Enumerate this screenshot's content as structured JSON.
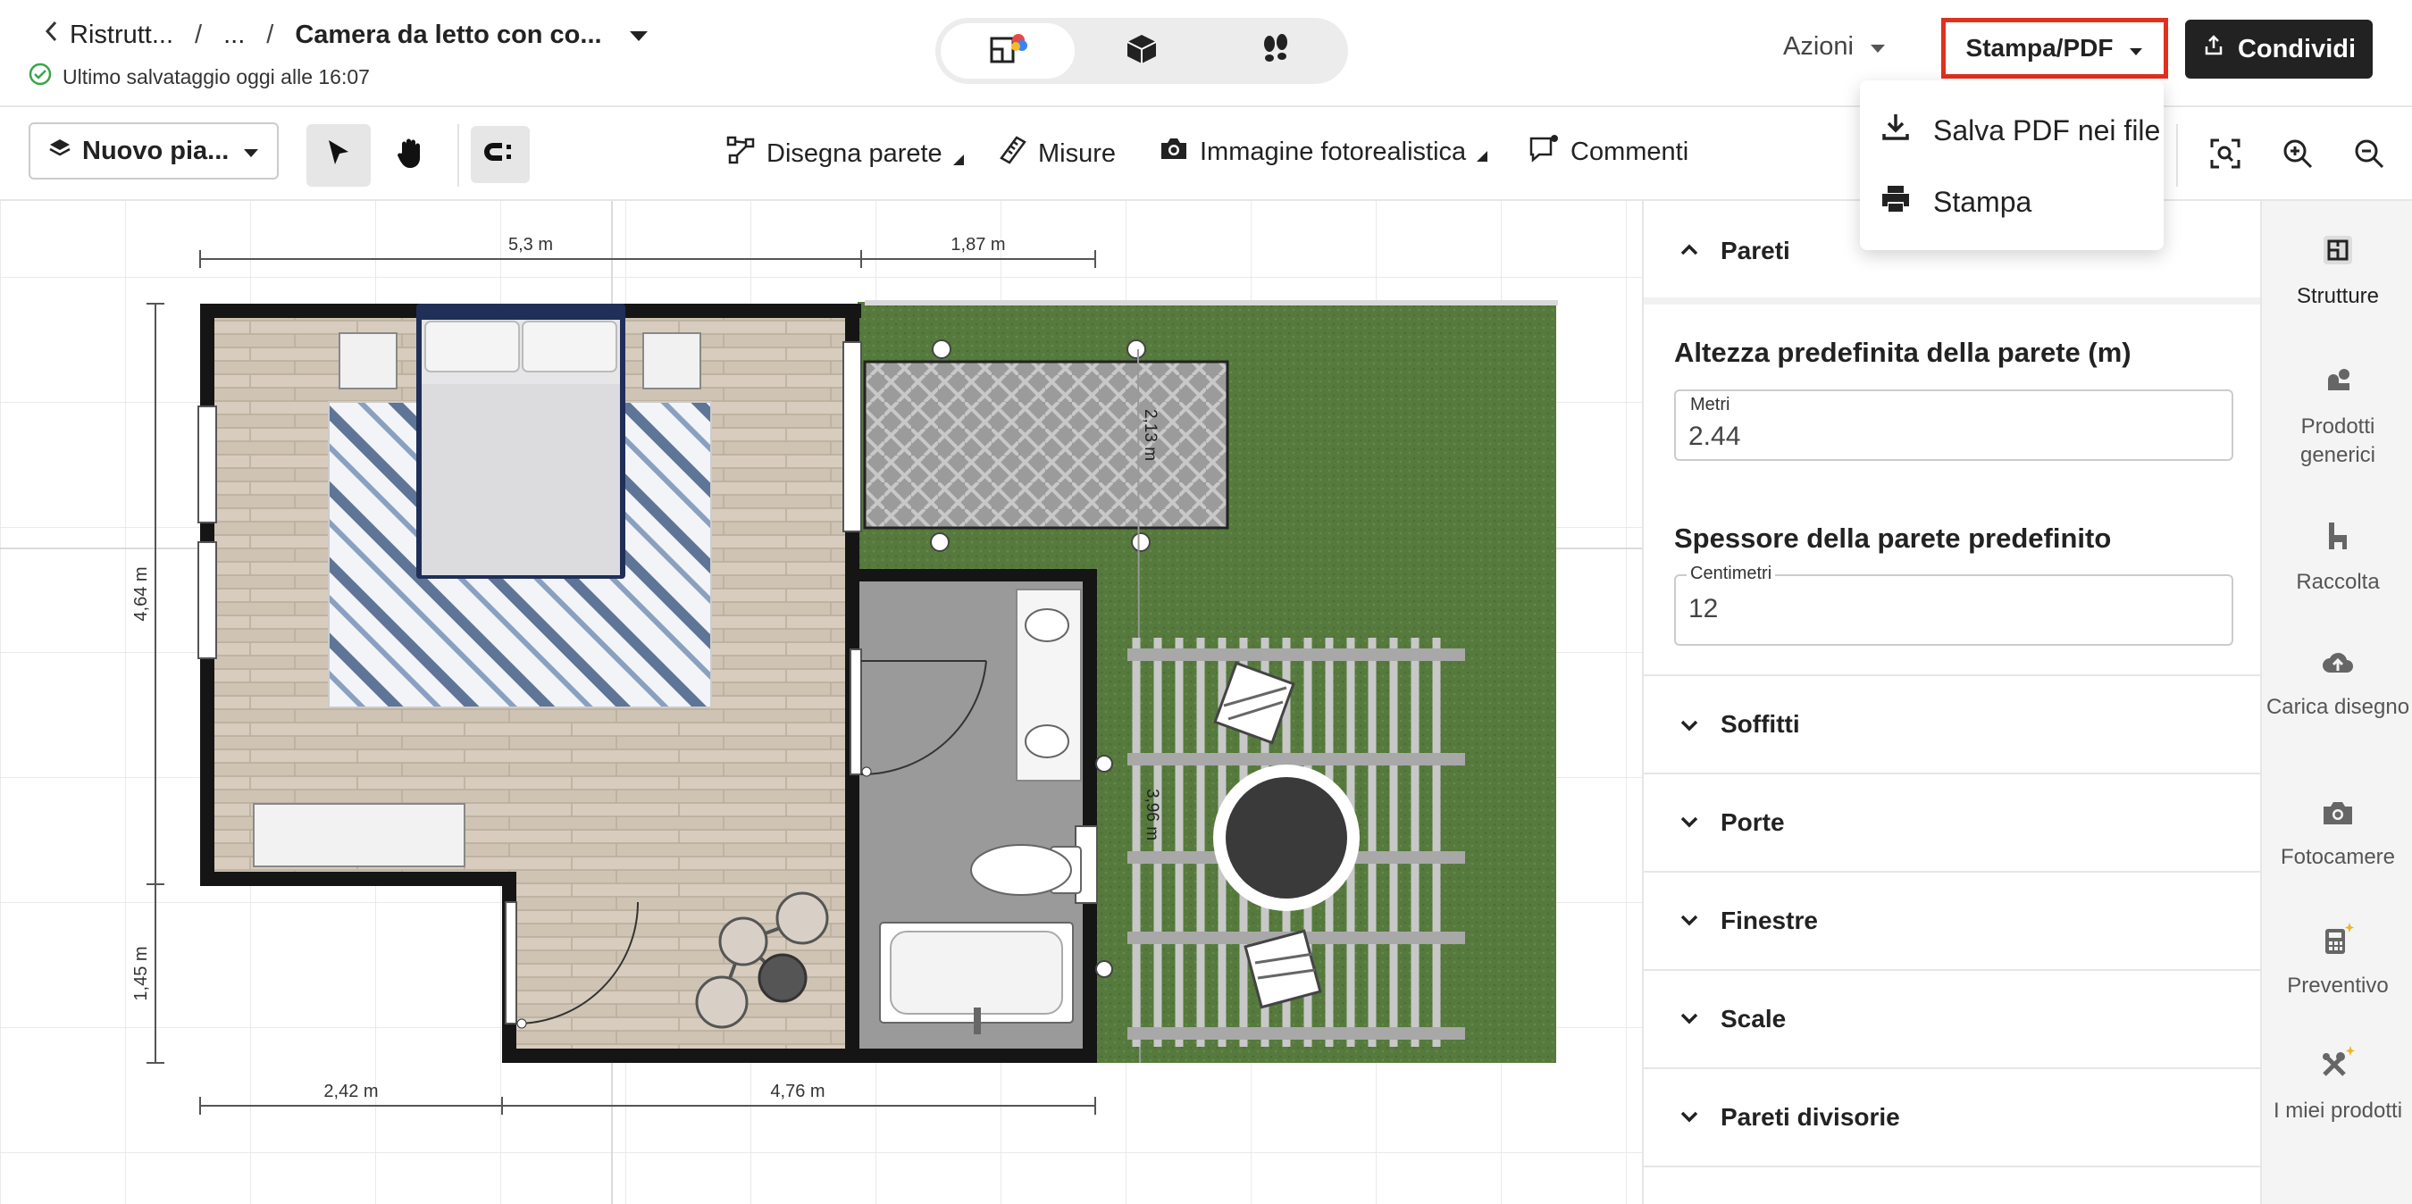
{
  "breadcrumb": {
    "back": "Ristrutt...",
    "ellipsis": "...",
    "current": "Camera da letto con co..."
  },
  "save_status": "Ultimo salvataggio oggi alle 16:07",
  "header": {
    "actions_label": "Azioni",
    "print_label": "Stampa/PDF",
    "share_label": "Condividi"
  },
  "dropdown": {
    "items": [
      {
        "label": "Salva PDF nei file",
        "icon": "download-icon"
      },
      {
        "label": "Stampa",
        "icon": "printer-icon"
      }
    ]
  },
  "toolbar": {
    "floor": "Nuovo pia...",
    "draw_wall": "Disegna parete",
    "measures": "Misure",
    "photo": "Immagine fotorealistica",
    "comments": "Commenti"
  },
  "plan": {
    "dims": {
      "top_left": "5,3 m",
      "top_right": "1,87 m",
      "left_top": "4,64 m",
      "left_bottom": "1,45 m",
      "bottom_left": "2,42 m",
      "bottom_right": "4,76 m",
      "patio": "2,13 m",
      "pergola": "3,96 m"
    }
  },
  "panel": {
    "pareti": "Pareti",
    "height_title": "Altezza predefinita della parete (m)",
    "height_label": "Metri",
    "height_value": "2.44",
    "thickness_title": "Spessore della parete predefinito",
    "thickness_label": "Centimetri",
    "thickness_value": "12",
    "sections": [
      "Soffitti",
      "Porte",
      "Finestre",
      "Scale",
      "Pareti divisorie"
    ]
  },
  "rail": {
    "items": [
      {
        "label": "Strutture",
        "icon": "structures-icon"
      },
      {
        "label": "Prodotti generici",
        "icon": "generic-products-icon"
      },
      {
        "label": "Raccolta",
        "icon": "collection-icon"
      },
      {
        "label": "Carica disegno",
        "icon": "upload-cloud-icon"
      },
      {
        "label": "Fotocamere",
        "icon": "camera-icon"
      },
      {
        "label": "Preventivo",
        "icon": "calculator-icon"
      },
      {
        "label": "I miei prodotti",
        "icon": "my-products-icon"
      }
    ]
  },
  "colors": {
    "accent_red": "#e0301e",
    "dark_button": "#222222",
    "grass": "#567a3d",
    "wall": "#151515",
    "wood_floor": "#cfc4b4",
    "tile_floor": "#9a9a9a",
    "saved_green": "#3aa54a"
  }
}
